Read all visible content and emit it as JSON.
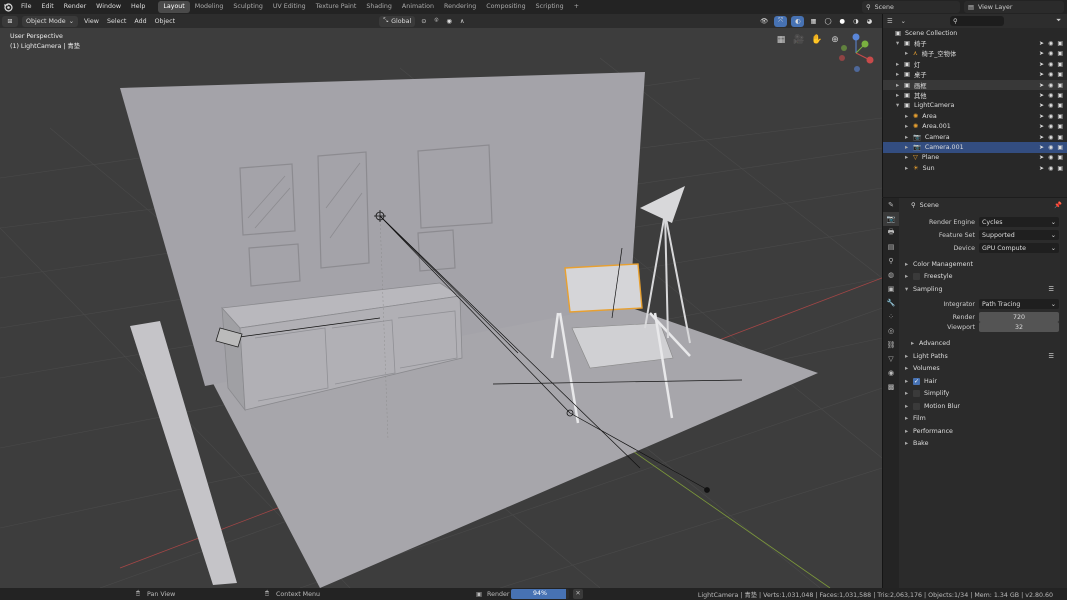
{
  "menu": [
    "File",
    "Edit",
    "Render",
    "Window",
    "Help"
  ],
  "workspaces": [
    "Layout",
    "Modeling",
    "Sculpting",
    "UV Editing",
    "Texture Paint",
    "Shading",
    "Animation",
    "Rendering",
    "Compositing",
    "Scripting"
  ],
  "active_workspace": "Layout",
  "scene": "Scene",
  "view_layer": "View Layer",
  "header": {
    "mode": "Object Mode",
    "view": "View",
    "select": "Select",
    "add": "Add",
    "object": "Object",
    "orientation": "Global"
  },
  "viewport": {
    "perspective": "User Perspective",
    "active": "(1) LightCamera | 青垫"
  },
  "outliner": {
    "rows": [
      {
        "label": "Scene Collection",
        "indent": 0,
        "icon": "collection-icon"
      },
      {
        "label": "椅子",
        "indent": 1,
        "icon": "collection-icon"
      },
      {
        "label": "椅子_空物体",
        "indent": 2,
        "icon": "empty-icon"
      },
      {
        "label": "灯",
        "indent": 1,
        "icon": "collection-icon"
      },
      {
        "label": "桌子",
        "indent": 1,
        "icon": "collection-icon"
      },
      {
        "label": "画框",
        "indent": 1,
        "icon": "collection-icon",
        "hl": true
      },
      {
        "label": "其他",
        "indent": 1,
        "icon": "collection-icon"
      },
      {
        "label": "LightCamera",
        "indent": 1,
        "icon": "collection-icon"
      },
      {
        "label": "Area",
        "indent": 2,
        "icon": "light-icon"
      },
      {
        "label": "Area.001",
        "indent": 2,
        "icon": "light-icon"
      },
      {
        "label": "Camera",
        "indent": 2,
        "icon": "camera-icon"
      },
      {
        "label": "Camera.001",
        "indent": 2,
        "icon": "camera-icon",
        "sel": true
      },
      {
        "label": "Plane",
        "indent": 2,
        "icon": "mesh-icon"
      },
      {
        "label": "Sun",
        "indent": 2,
        "icon": "sun-icon"
      }
    ]
  },
  "properties": {
    "context": "Scene",
    "render_engine_label": "Render Engine",
    "render_engine": "Cycles",
    "feature_set_label": "Feature Set",
    "feature_set": "Supported",
    "device_label": "Device",
    "device": "GPU Compute",
    "color_management": "Color Management",
    "freestyle": "Freestyle",
    "sampling": "Sampling",
    "integrator_label": "Integrator",
    "integrator": "Path Tracing",
    "render_label": "Render",
    "render_samples": "720",
    "viewport_label": "Viewport",
    "viewport_samples": "32",
    "advanced": "Advanced",
    "light_paths": "Light Paths",
    "volumes": "Volumes",
    "hair": "Hair",
    "simplify": "Simplify",
    "motion_blur": "Motion Blur",
    "film": "Film",
    "performance": "Performance",
    "bake": "Bake"
  },
  "status": {
    "pan": "Pan View",
    "context_menu": "Context Menu",
    "render_label": "Render",
    "progress_text": "94%",
    "progress": 0.94,
    "stats": "LightCamera | 青垫 | Verts:1,031,048 | Faces:1,031,588 | Tris:2,063,176 | Objects:1/34 | Mem: 1.34 GB | v2.80.60"
  },
  "colors": {
    "accent": "#4772b3",
    "selection": "#334d80",
    "orange": "#e8a030"
  }
}
